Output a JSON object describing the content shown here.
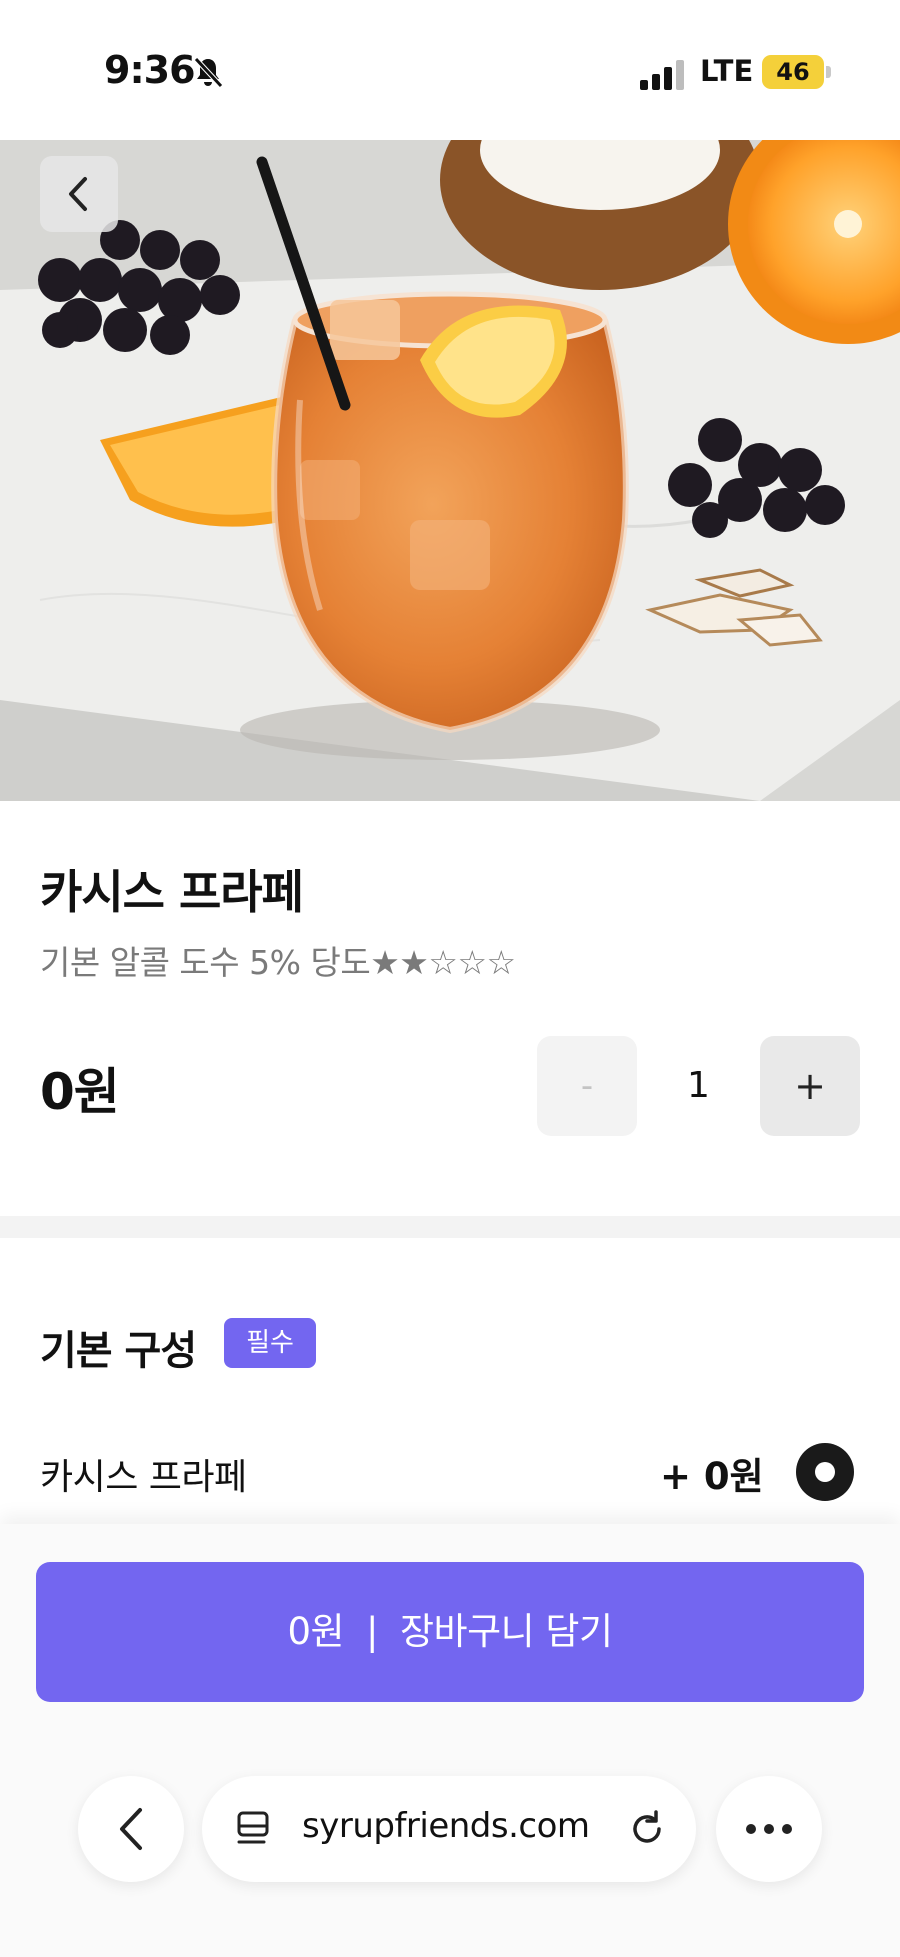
{
  "status_bar": {
    "time": "9:36",
    "network": "LTE",
    "battery": "46"
  },
  "hero": {
    "back_icon": "chevron-left-icon",
    "image": "orange-cassis-drink-photo"
  },
  "product": {
    "name": "카시스 프라페",
    "description": "기본 알콜 도수 5%  당도★★☆☆☆",
    "price": "0원",
    "sweetness_rating": 2,
    "sweetness_max": 5
  },
  "quantity": {
    "minus_label": "-",
    "value": "1",
    "plus_label": "+"
  },
  "options_section": {
    "title": "기본 구성",
    "badge": "필수",
    "items": [
      {
        "label": "카시스 프라페",
        "price": "+ 0원",
        "selected": true
      }
    ]
  },
  "cart_button": {
    "price": "0원",
    "separator": "|",
    "label": "장바구니 담기"
  },
  "browser": {
    "back_icon": "chevron-left-icon",
    "page_icon": "page-icon",
    "url": "syrupfriends.com",
    "reload_icon": "reload-icon",
    "more_icon": "more-icon"
  },
  "colors": {
    "accent": "#7366f0",
    "battery": "#f4d03a"
  }
}
